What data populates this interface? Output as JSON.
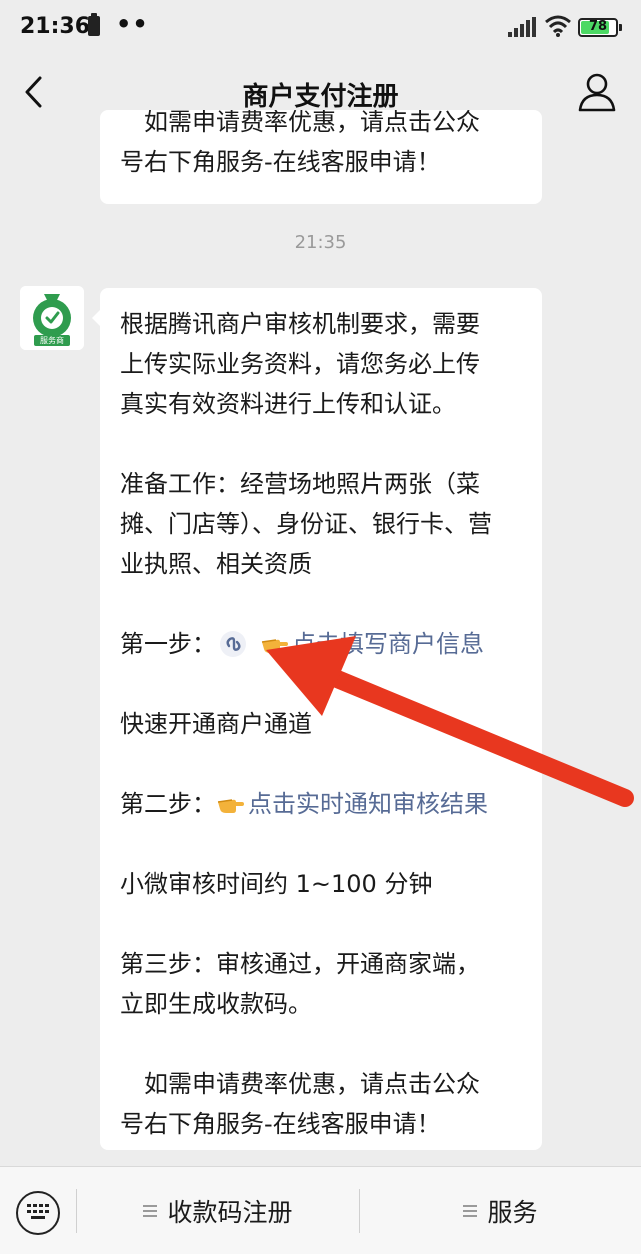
{
  "status_bar": {
    "time": "21:36",
    "dots": "••",
    "battery": "78"
  },
  "header": {
    "title": "商户支付注册"
  },
  "chat": {
    "prev_message_lines": [
      "　如需申请费率优惠，请点击公众",
      "号右下角服务-在线客服申请！"
    ],
    "timestamp": "21:35",
    "avatar_label": "服务商",
    "message": {
      "p1": [
        "根据腾讯商户审核机制要求，需要",
        "上传实际业务资料，请您务必上传",
        "真实有效资料进行上传和认证。"
      ],
      "p2": [
        "准备工作：经营场地照片两张（菜",
        "摊、门店等）、身份证、银行卡、营",
        "业执照、相关资质"
      ],
      "step1_label": "第一步：",
      "step1_link": "点击填写商户信息",
      "step1_desc": "快速开通商户通道",
      "step2_label": "第二步：",
      "step2_link": "点击实时通知审核结果",
      "step2_desc": "小微审核时间约 1~100 分钟",
      "p3": [
        "第三步：审核通过，开通商家端，",
        "立即生成收款码。"
      ],
      "p4": [
        "　如需申请费率优惠，请点击公众",
        "号右下角服务-在线客服申请！"
      ]
    }
  },
  "bottom_menu": {
    "items": [
      "收款码注册",
      "服务"
    ]
  },
  "colors": {
    "link": "#576b95",
    "arrow": "#e8371f",
    "avatar_green": "#2f9c4e"
  }
}
